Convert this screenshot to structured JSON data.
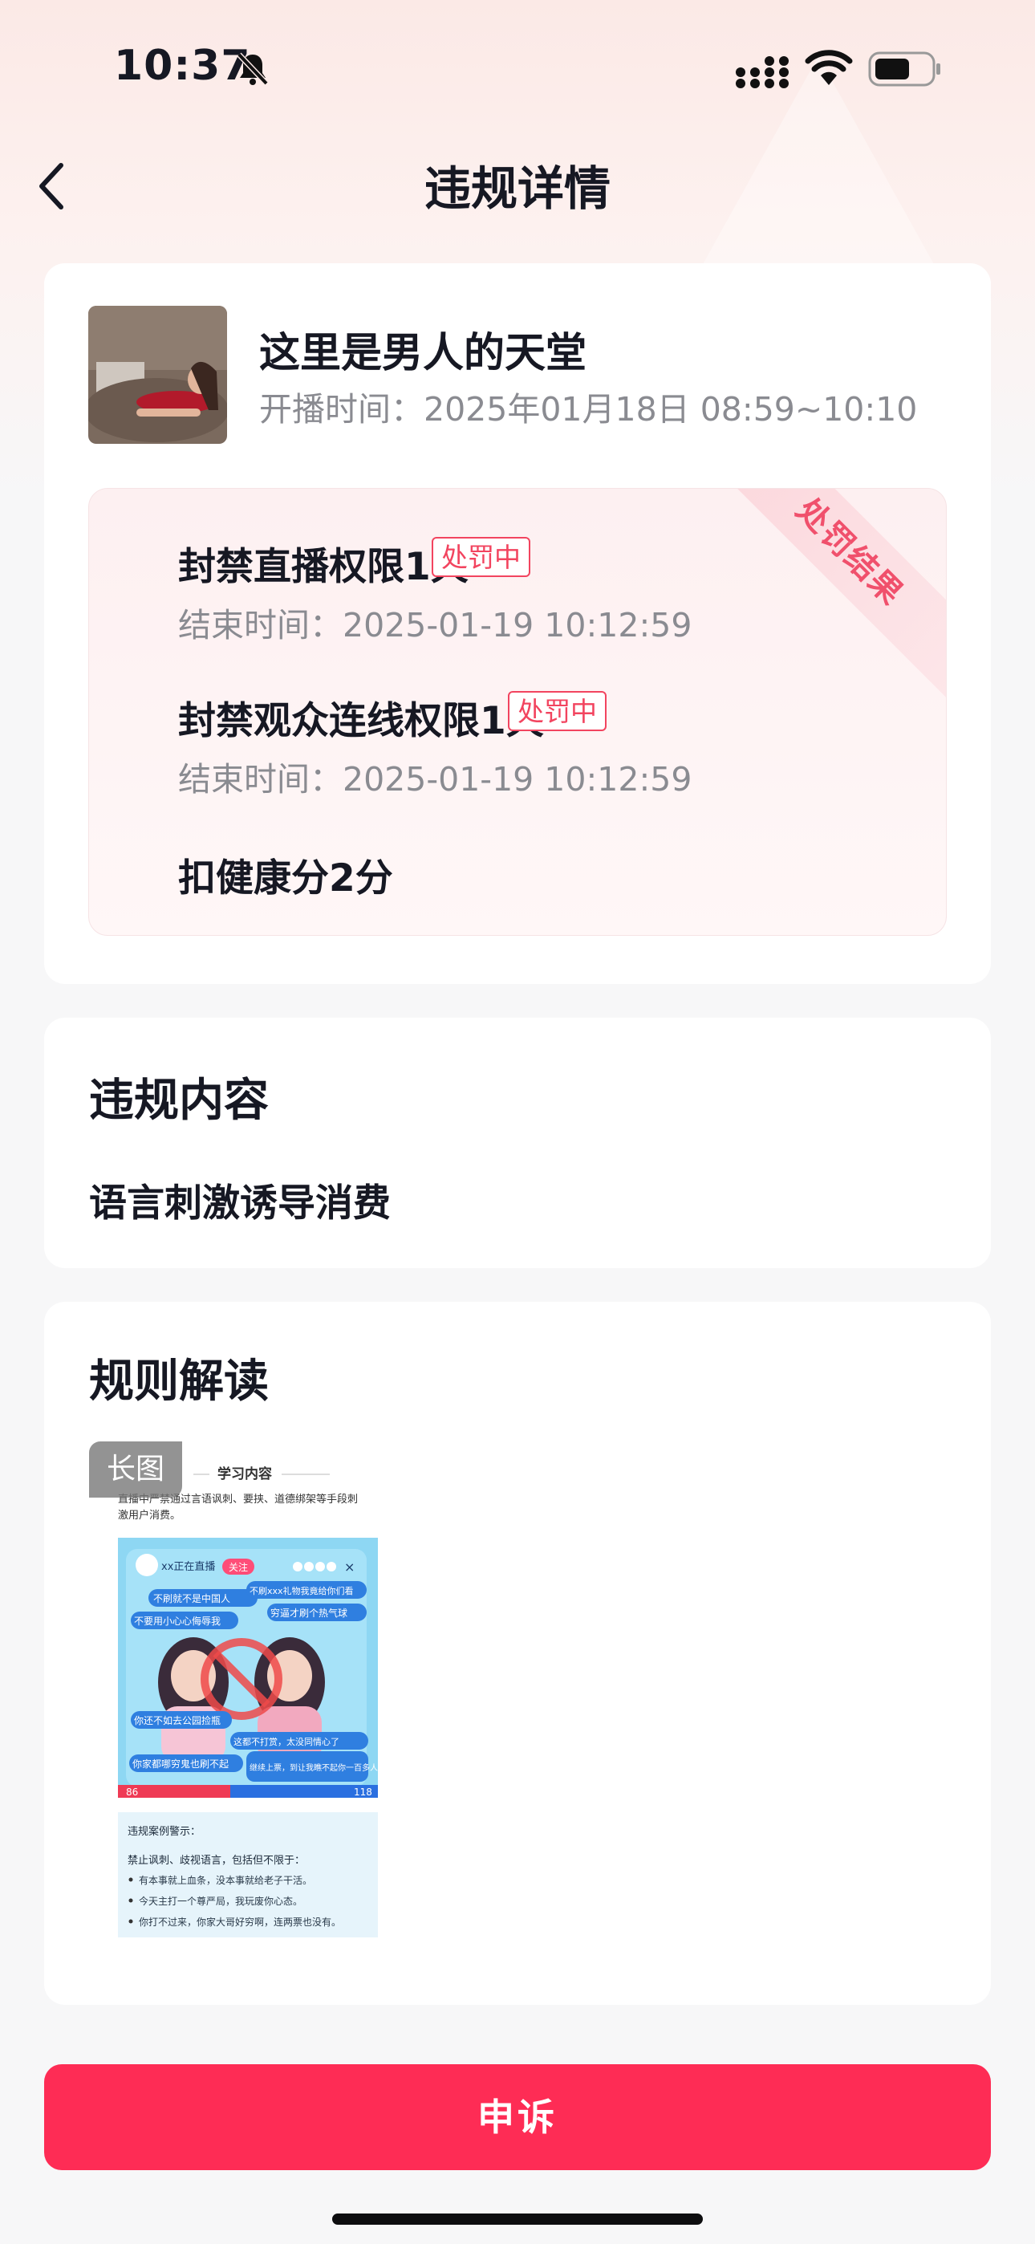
{
  "status_bar": {
    "time": "10:37"
  },
  "nav": {
    "title": "违规详情"
  },
  "live": {
    "title": "这里是男人的天堂",
    "time_label": "开播时间：",
    "time_value": "2025年01月18日 08:59~10:10"
  },
  "penalty": {
    "ribbon": "处罚结果",
    "items": [
      {
        "title": "封禁直播权限1天",
        "tag": "处罚中",
        "end_label": "结束时间：",
        "end_value": "2025-01-19 10:12:59"
      },
      {
        "title": "封禁观众连线权限1天",
        "tag": "处罚中",
        "end_label": "结束时间：",
        "end_value": "2025-01-19 10:12:59"
      },
      {
        "title": "扣健康分2分"
      }
    ]
  },
  "violation": {
    "title": "违规内容",
    "content": "语言刺激诱导消费"
  },
  "rules": {
    "title": "规则解读",
    "badge": "长图",
    "preview": {
      "heading": "学习内容",
      "intro_1": "直播中严禁通过言语讽刺、要挟、道德绑架等手段刺",
      "intro_2": "激用户消费。",
      "live_label": "xx正在直播",
      "follow": "关注",
      "bubbles": [
        "不刷就不是中国人",
        "不刷xxx礼物我竟给你们看",
        "不要用小心心侮辱我",
        "穷逼才刷个热气球",
        "你还不如去公园捡瓶",
        "这都不打赏，太没同情心了",
        "你家都哪穷鬼也刷不起",
        "继续上票，到让我瞧不起你一百多人"
      ],
      "score_left": "86",
      "score_right": "118",
      "warn_title": "违规案例警示：",
      "warn_sub": "禁止讽刺、歧视语言，包括但不限于：",
      "warn_items": [
        "有本事就上血条，没本事就给老子干活。",
        "今天主打一个尊严局，我玩废你心态。",
        "你打不过来，你家大哥好穷啊，连两票也没有。"
      ]
    }
  },
  "appeal": {
    "label": "申诉"
  },
  "colors": {
    "accent": "#fe2c55",
    "tag": "#f2445f",
    "secondary_text": "#8a8b91"
  }
}
